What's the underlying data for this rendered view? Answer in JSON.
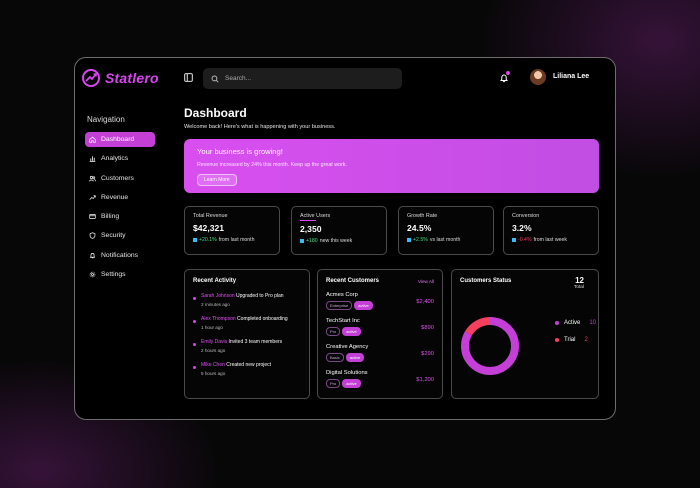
{
  "app": {
    "name": "Statlero"
  },
  "sidebar": {
    "title": "Navigation",
    "items": [
      {
        "label": "Dashboard",
        "icon": "home-icon",
        "active": true
      },
      {
        "label": "Analytics",
        "icon": "bar-chart-icon"
      },
      {
        "label": "Customers",
        "icon": "users-icon"
      },
      {
        "label": "Revenue",
        "icon": "trending-up-icon"
      },
      {
        "label": "Billing",
        "icon": "card-icon"
      },
      {
        "label": "Security",
        "icon": "shield-icon"
      },
      {
        "label": "Notifications",
        "icon": "bell-icon"
      },
      {
        "label": "Settings",
        "icon": "gear-icon"
      }
    ]
  },
  "header": {
    "search_placeholder": "Search...",
    "user_name": "Liliana Lee"
  },
  "main": {
    "title": "Dashboard",
    "subtitle": "Welcome back! Here's what is happening with your business.",
    "banner": {
      "title": "Your business is growing!",
      "text": "Revenue increased by 24% this month. Keep up the great work.",
      "button": "Learn More"
    },
    "stats": [
      {
        "label": "Total Revenue",
        "value": "$42,321",
        "change": "+20.1%",
        "change_text": "from last month",
        "tone": "pos"
      },
      {
        "label": "Active Users",
        "value": "2,350",
        "change": "+180",
        "change_text": "new this week",
        "tone": "pos"
      },
      {
        "label": "Growth Rate",
        "value": "24.5%",
        "change": "+2.5%",
        "change_text": "vs last month",
        "tone": "pos"
      },
      {
        "label": "Conversion",
        "value": "3.2%",
        "change": "-0.4%",
        "change_text": "from last week",
        "tone": "neg"
      }
    ],
    "activity": {
      "title": "Recent Activity",
      "items": [
        {
          "who": "Sarah Johnson",
          "action": "Upgraded to Pro plan",
          "time": "2 minutes ago"
        },
        {
          "who": "Alex Thompson",
          "action": "Completed onboarding",
          "time": "1 hour ago"
        },
        {
          "who": "Emily Davis",
          "action": "Invited 3 team members",
          "time": "2 hours ago"
        },
        {
          "who": "Mike Chen",
          "action": "Created new project",
          "time": "5 hours ago"
        }
      ]
    },
    "customers": {
      "title": "Recent Customers",
      "view_all": "View All",
      "items": [
        {
          "name": "Acmes Corp",
          "plan": "Enterprise",
          "status": "active",
          "amount": "$2,400"
        },
        {
          "name": "TechStart Inc",
          "plan": "Pro",
          "status": "active",
          "amount": "$890"
        },
        {
          "name": "Creative Agency",
          "plan": "Basic",
          "status": "active",
          "amount": "$290"
        },
        {
          "name": "Digital Solutions",
          "plan": "Pro",
          "status": "active",
          "amount": "$1,200"
        }
      ]
    },
    "customer_status": {
      "title": "Customers Status",
      "total": "12",
      "total_label": "Total",
      "segments": [
        {
          "label": "Active",
          "count": "10",
          "value": 10,
          "color": "#c43fd6"
        },
        {
          "label": "Trial",
          "count": "2",
          "value": 2,
          "color": "#f43f5e"
        }
      ]
    }
  },
  "colors": {
    "accent": "#d946ef",
    "negative": "#f43f5e",
    "positive": "#4ade80"
  }
}
